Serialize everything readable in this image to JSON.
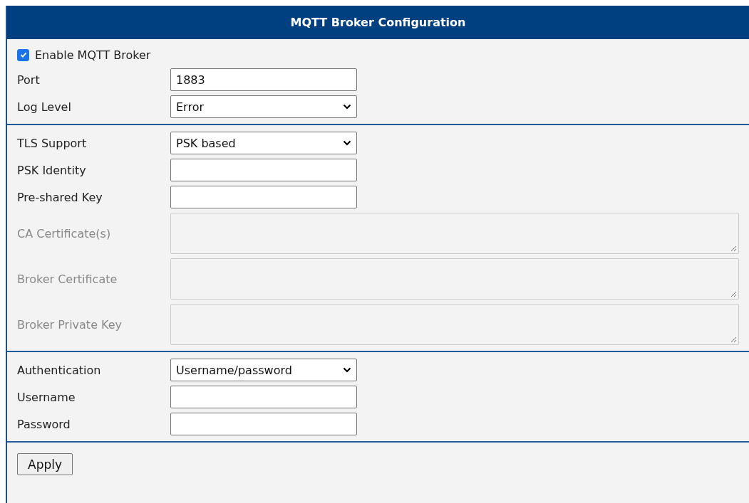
{
  "title": "MQTT Broker Configuration",
  "sections": [
    {
      "rows": [
        {
          "kind": "checkbox",
          "label": "Enable MQTT Broker",
          "checked": true
        },
        {
          "kind": "text",
          "label": "Port",
          "value": "1883"
        },
        {
          "kind": "select",
          "label": "Log Level",
          "value": "Error"
        }
      ]
    },
    {
      "rows": [
        {
          "kind": "select",
          "label": "TLS Support",
          "value": "PSK based"
        },
        {
          "kind": "text",
          "label": "PSK Identity"
        },
        {
          "kind": "text",
          "label": "Pre-shared Key"
        },
        {
          "kind": "textarea",
          "label": "CA Certificate(s)",
          "disabled": true
        },
        {
          "kind": "textarea",
          "label": "Broker Certificate",
          "disabled": true
        },
        {
          "kind": "textarea",
          "label": "Broker Private Key",
          "disabled": true
        }
      ]
    },
    {
      "rows": [
        {
          "kind": "select",
          "label": "Authentication",
          "value": "Username/password"
        },
        {
          "kind": "text",
          "label": "Username"
        },
        {
          "kind": "text",
          "label": "Password"
        }
      ]
    }
  ],
  "button": "Apply"
}
